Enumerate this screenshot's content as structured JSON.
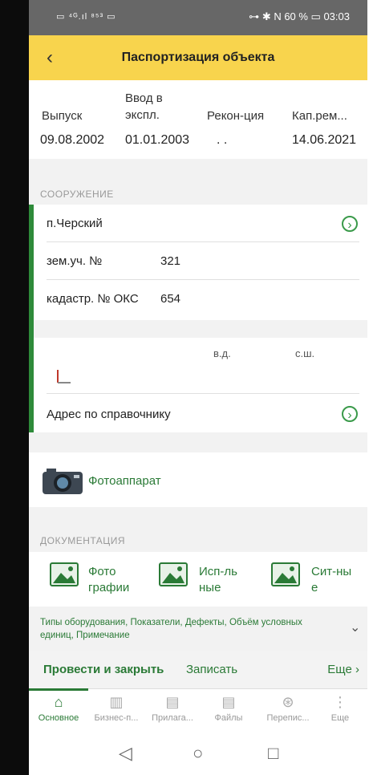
{
  "status_bar": {
    "left_icons": "▭ ⁴ᴳ.ıl ⁸⁵³ ▭",
    "right_text": "⊶ ✱ N 60 % ▭ 03:03"
  },
  "header": {
    "title": "Паспортизация объекта"
  },
  "dates": [
    {
      "label": "Выпуск",
      "value": "09.08.2002"
    },
    {
      "label": "Ввод в\nэкспл.",
      "value": "01.01.2003"
    },
    {
      "label": "Рекон-ция",
      "value": ". ."
    },
    {
      "label": "Кап.рем...",
      "value": "14.06.2021"
    }
  ],
  "sooruzhenie": {
    "section_label": "СООРУЖЕНИЕ",
    "place": "п.Черский",
    "zem_label": "зем.уч. №",
    "zem_value": "321",
    "kadastr_label": "кадастр. № ОКС",
    "kadastr_value": "654"
  },
  "coords": {
    "vd_label": "в.д.",
    "ssh_label": "с.ш.",
    "address_label": "Адрес по справочнику"
  },
  "photo": {
    "label": "Фотоаппарат"
  },
  "documentation": {
    "section_label": "ДОКУМЕНТАЦИЯ",
    "items": [
      {
        "label": "Фото\nграфии"
      },
      {
        "label": "Исп-ль\nные"
      },
      {
        "label": "Сит-ны\nе"
      }
    ]
  },
  "types_link": "Типы оборудования, Показатели, Дефекты, Объём условных единиц, Примечание",
  "actions": {
    "post_close": "Провести и закрыть",
    "save": "Записать",
    "more": "Еще"
  },
  "tabs": [
    {
      "label": "Основное",
      "active": true
    },
    {
      "label": "Бизнес-п..."
    },
    {
      "label": "Прилага..."
    },
    {
      "label": "Файлы"
    },
    {
      "label": "Перепис..."
    },
    {
      "label": "Еще"
    }
  ],
  "colors": {
    "accent_green": "#2a7a36",
    "header_yellow": "#f8d44d",
    "green_bar": "#2e8b3a"
  }
}
